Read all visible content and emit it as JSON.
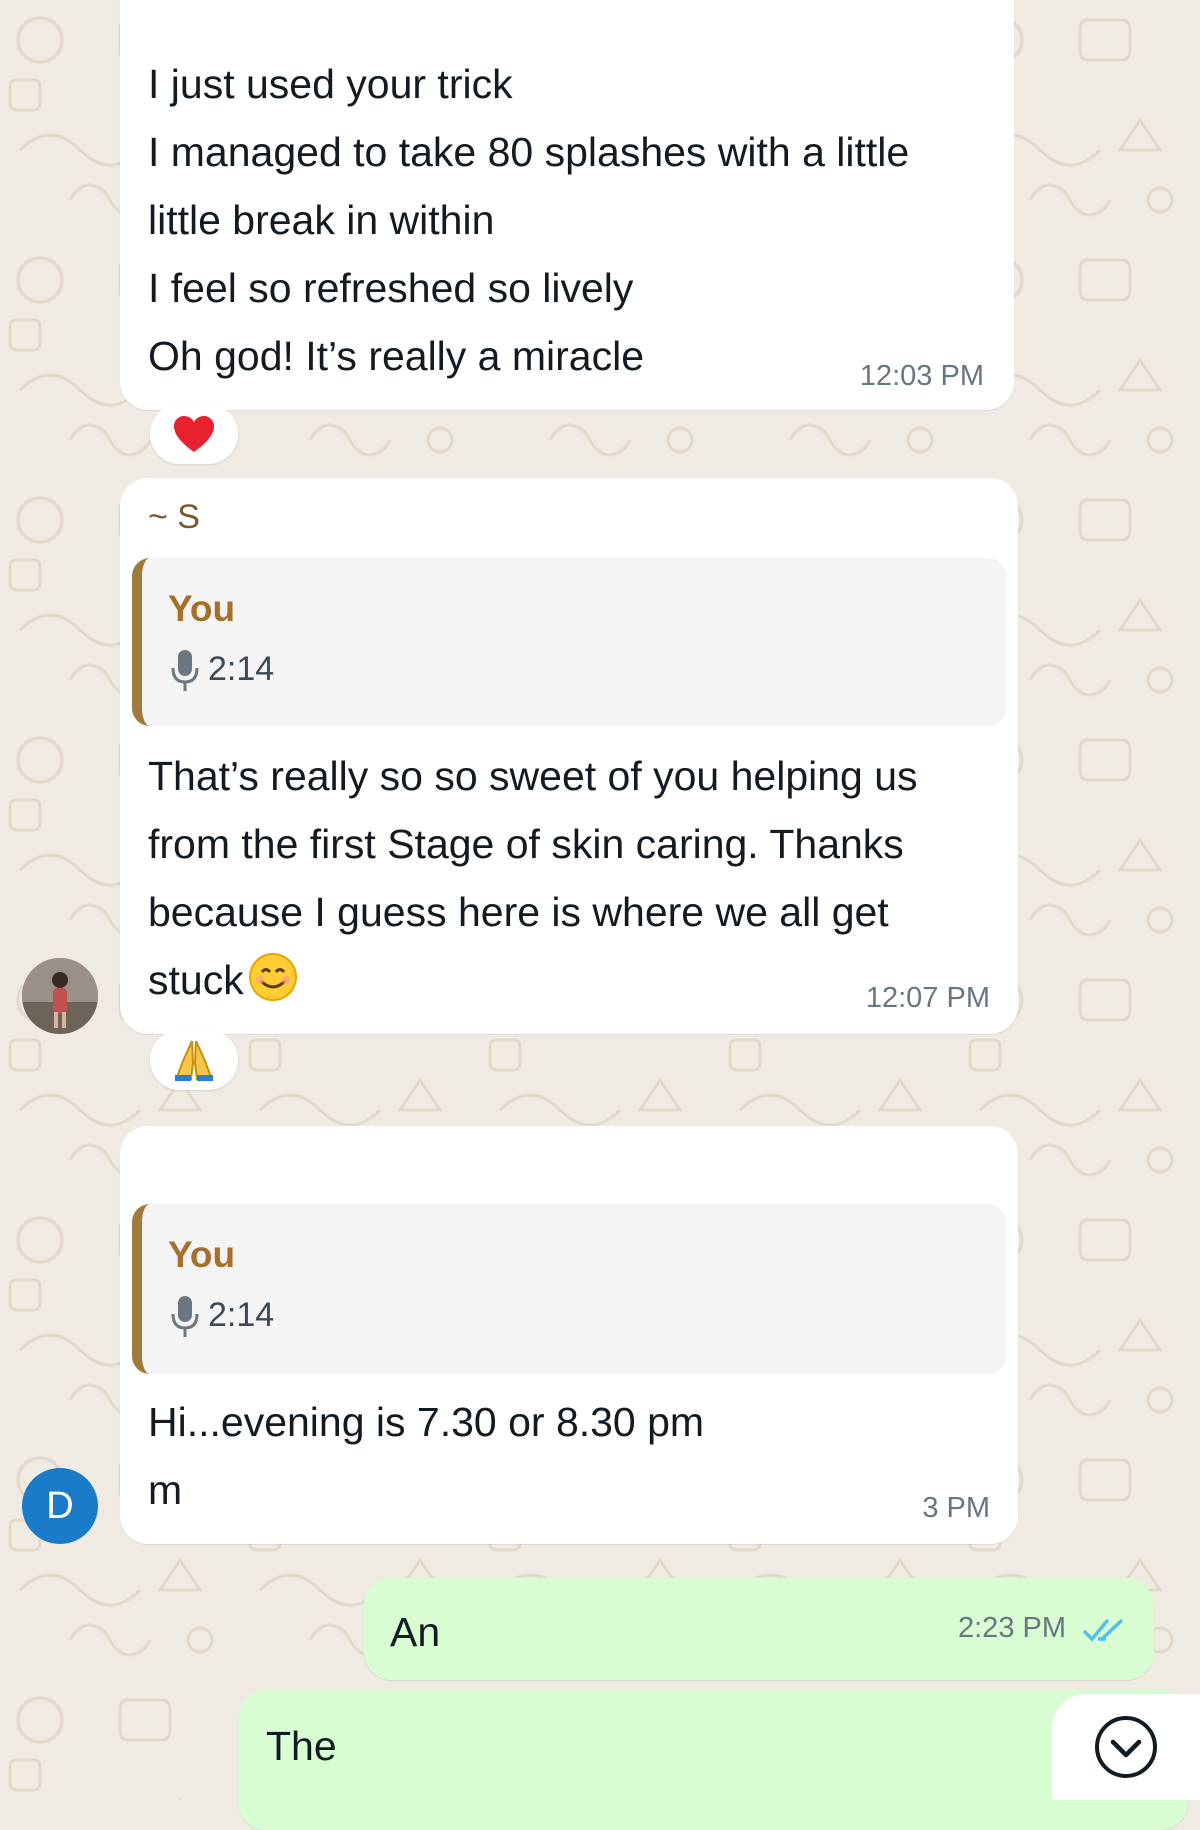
{
  "messages": [
    {
      "lines": [
        "I just used your trick",
        "I managed to take 80 splashes with a little",
        "little break in within",
        "I feel so refreshed so lively",
        "Oh god! It’s really a miracle"
      ],
      "time": "12:03 PM",
      "reaction": "❤️"
    },
    {
      "sender": "~ S",
      "quote": {
        "author": "You",
        "duration": "2:14"
      },
      "lines": [
        "That’s really so so sweet of you helping us",
        "from the first Stage of skin caring. Thanks",
        "because I guess here is where we all get",
        "stuck"
      ],
      "time": "12:07 PM",
      "reaction": "🙏"
    },
    {
      "quote": {
        "author": "You",
        "duration": "2:14"
      },
      "lines": [
        "Hi...evening is 7.30 or 8.30 pm",
        "m"
      ],
      "time": "3 PM",
      "avatar_letter": "D"
    },
    {
      "text": "An",
      "time": "2:23 PM"
    },
    {
      "text": "The"
    }
  ],
  "colors": {
    "wallpaper": "#efeae2",
    "incoming_bubble": "#ffffff",
    "outgoing_bubble": "#d9fdd3",
    "quote_author": "#a4702c",
    "read_ticks": "#53bdeb",
    "avatar_d": "#1a7cc9"
  },
  "icons": {
    "quote_mic": "microphone-icon",
    "read_receipt": "double-check-icon",
    "scroll_down": "chevron-down-circle-icon"
  }
}
